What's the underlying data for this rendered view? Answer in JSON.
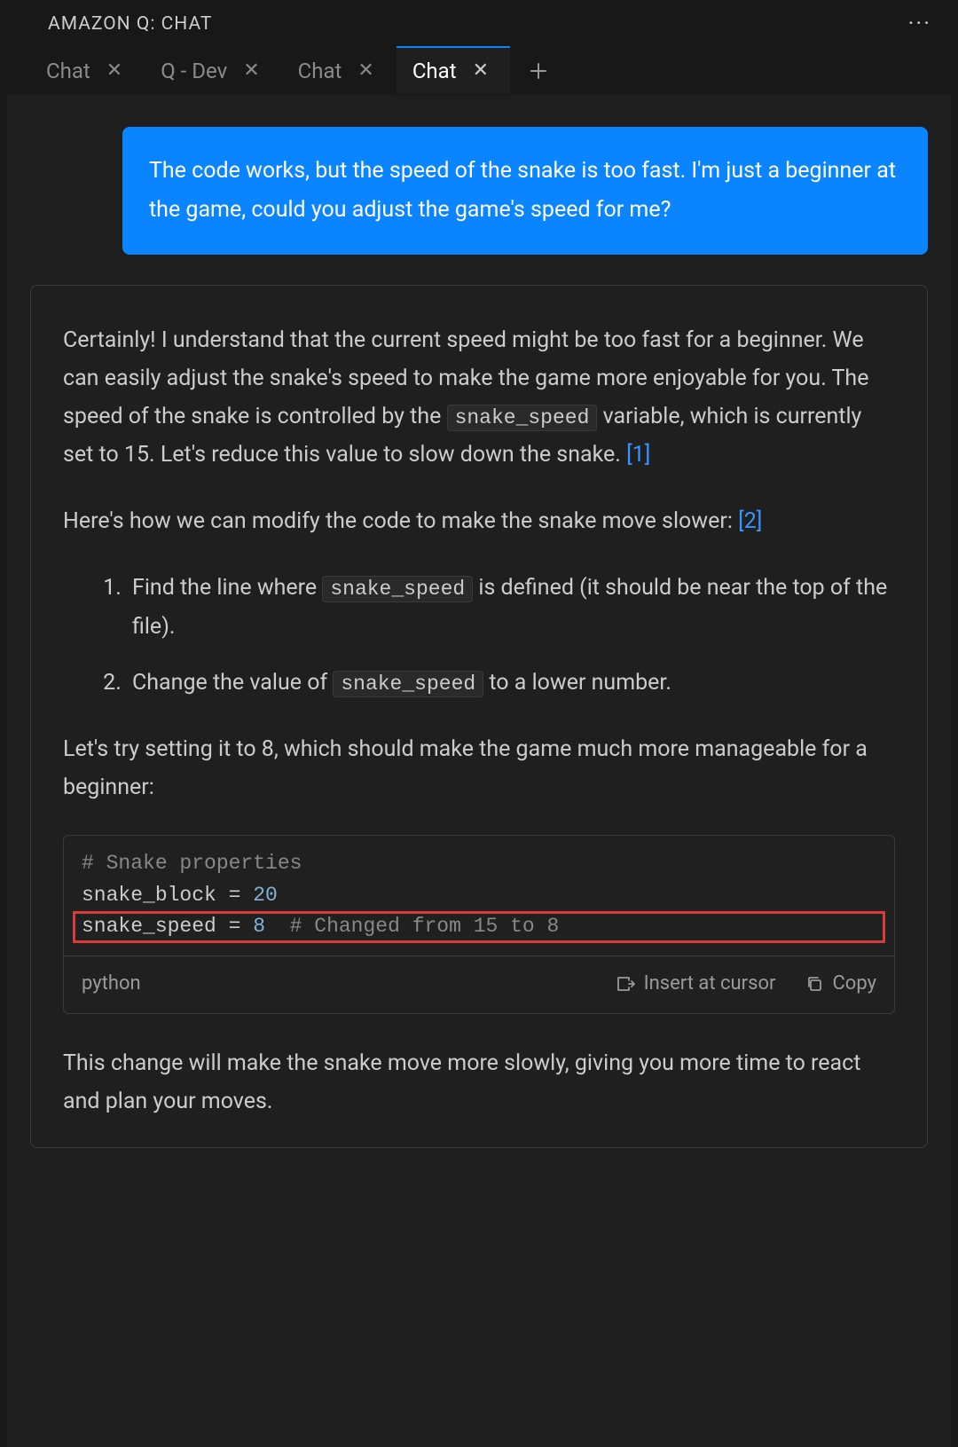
{
  "panel": {
    "title": "AMAZON Q: CHAT"
  },
  "tabs": [
    {
      "label": "Chat",
      "active": false
    },
    {
      "label": "Q - Dev",
      "active": false
    },
    {
      "label": "Chat",
      "active": false
    },
    {
      "label": "Chat",
      "active": true
    }
  ],
  "user_message": "The code works, but the speed of the snake is too fast. I'm just a beginner at the game, could you adjust the game's speed for me?",
  "assistant": {
    "p1_a": "Certainly! I understand that the current speed might be too fast for a beginner. We can easily adjust the snake's speed to make the game more enjoyable for you. The speed of the snake is controlled by the ",
    "p1_code": "snake_speed",
    "p1_b": " variable, which is currently set to 15. Let's reduce this value to slow down the snake. ",
    "cite1": "[1]",
    "p2_a": "Here's how we can modify the code to make the snake move slower: ",
    "cite2": "[2]",
    "li1_a": "Find the line where ",
    "li1_code": "snake_speed",
    "li1_b": " is defined (it should be near the top of the file).",
    "li2_a": "Change the value of ",
    "li2_code": "snake_speed",
    "li2_b": " to a lower number.",
    "p3": "Let's try setting it to 8, which should make the game much more manageable for a beginner:",
    "code": {
      "line1": "# Snake properties",
      "line2_a": "snake_block ",
      "line2_op": "=",
      "line2_b": " 20",
      "line3_a": "snake_speed ",
      "line3_op": "=",
      "line3_b": " 8",
      "line3_c": "  # Changed from 15 to 8",
      "lang": "python",
      "insert_label": "Insert at cursor",
      "copy_label": "Copy"
    },
    "p4": "This change will make the snake move more slowly, giving you more time to react and plan your moves."
  }
}
